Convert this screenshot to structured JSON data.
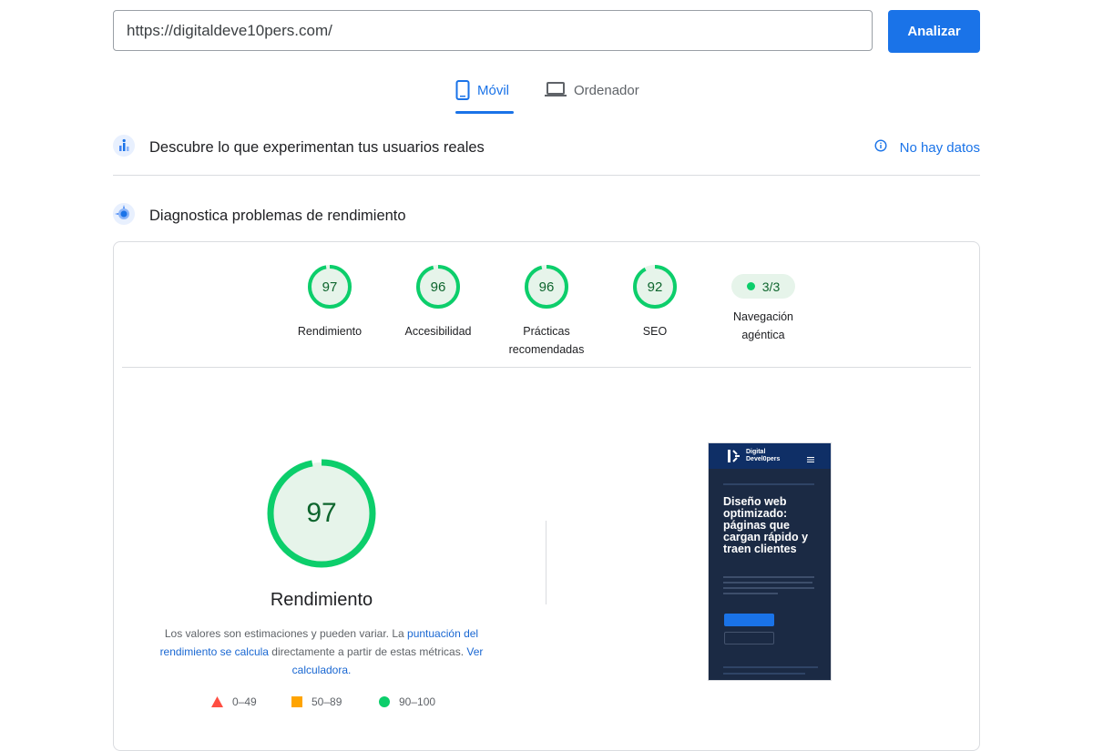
{
  "search": {
    "url_value": "https://digitaldeve10pers.com/",
    "analyze_label": "Analizar"
  },
  "tabs": [
    {
      "label": "Móvil",
      "icon": "smartphone-icon",
      "active": true
    },
    {
      "label": "Ordenador",
      "icon": "laptop-icon",
      "active": false
    }
  ],
  "field_data": {
    "title": "Descubre lo que experimentan tus usuarios reales",
    "status": "No hay datos"
  },
  "diagnostics": {
    "title": "Diagnostica problemas de rendimiento"
  },
  "scores": [
    {
      "label": "Rendimiento",
      "value": "97",
      "fraction": 0.97
    },
    {
      "label": "Accesibilidad",
      "value": "96",
      "fraction": 0.96
    },
    {
      "label": "Prácticas recomendadas",
      "value": "96",
      "fraction": 0.96
    },
    {
      "label": "SEO",
      "value": "92",
      "fraction": 0.92
    }
  ],
  "agentic": {
    "label": "Navegación agéntica",
    "value": "3/3"
  },
  "performance": {
    "score": "97",
    "fraction": 0.97,
    "title": "Rendimiento",
    "desc_part1": "Los valores son estimaciones y pueden variar. La ",
    "desc_link1": "puntuación del rendimiento se calcula",
    "desc_part2": " directamente a partir de estas métricas. ",
    "desc_link2": "Ver calculadora."
  },
  "legend": [
    {
      "label": "0–49",
      "color": "#ff4e42",
      "shape": "triangle"
    },
    {
      "label": "50–89",
      "color": "#ffa400",
      "shape": "square"
    },
    {
      "label": "90–100",
      "color": "#0cce6b",
      "shape": "circle"
    }
  ],
  "preview": {
    "logo_line1": "Digital",
    "logo_line2": "Devel0pers",
    "hero": "Diseño web optimizado: páginas que cargan rápido y traen clientes"
  },
  "colors": {
    "accent": "#1a73e8",
    "pass_green": "#0cce6b",
    "pass_green_text": "#0d652d",
    "pass_fill": "#e6f4ea"
  }
}
